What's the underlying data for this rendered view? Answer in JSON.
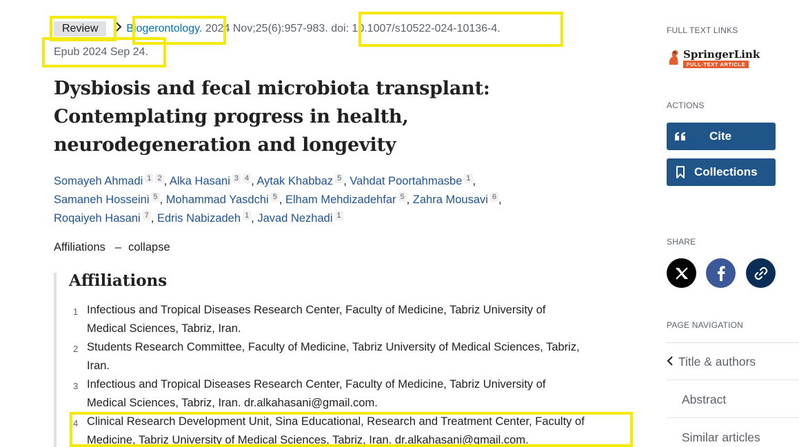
{
  "citation": {
    "badge": "Review",
    "journal": "Biogerontology.",
    "details": "2024 Nov;25(6):957-983.",
    "doi": "doi: 10.1007/s10522-024-10136-4.",
    "epub": "Epub 2024 Sep 24."
  },
  "title_lines": [
    "Dysbiosis and fecal microbiota transplant:",
    "Contemplating progress in health,",
    "neurodegeneration and longevity"
  ],
  "authors": [
    {
      "name": "Somayeh Ahmadi",
      "affs": [
        "1",
        "2"
      ]
    },
    {
      "name": "Alka Hasani",
      "affs": [
        "3",
        "4"
      ]
    },
    {
      "name": "Aytak Khabbaz",
      "affs": [
        "5"
      ]
    },
    {
      "name": "Vahdat Poortahmasbe",
      "affs": [
        "1"
      ]
    },
    {
      "name": "Samaneh Hosseini",
      "affs": [
        "5"
      ]
    },
    {
      "name": "Mohammad Yasdchi",
      "affs": [
        "5"
      ]
    },
    {
      "name": "Elham Mehdizadehfar",
      "affs": [
        "5"
      ]
    },
    {
      "name": "Zahra Mousavi",
      "affs": [
        "6"
      ]
    },
    {
      "name": "Roqaiyeh Hasani",
      "affs": [
        "7"
      ]
    },
    {
      "name": "Edris Nabizadeh",
      "affs": [
        "1"
      ]
    },
    {
      "name": "Javad Nezhadi",
      "affs": [
        "1"
      ]
    }
  ],
  "affiliations_toggle": {
    "label": "Affiliations",
    "dash": "–",
    "action": "collapse"
  },
  "affiliations_heading": "Affiliations",
  "affiliations": [
    {
      "num": "1",
      "lines": [
        "Infectious and Tropical Diseases Research Center, Faculty of Medicine, Tabriz University of",
        "Medical Sciences, Tabriz, Iran."
      ]
    },
    {
      "num": "2",
      "lines": [
        "Students Research Committee, Faculty of Medicine, Tabriz University of Medical Sciences, Tabriz,",
        "Iran."
      ]
    },
    {
      "num": "3",
      "lines": [
        "Infectious and Tropical Diseases Research Center, Faculty of Medicine, Tabriz University of",
        "Medical Sciences, Tabriz, Iran. dr.alkahasani@gmail.com."
      ]
    },
    {
      "num": "4",
      "lines": [
        "Clinical Research Development Unit, Sina Educational, Research and Treatment Center, Faculty of",
        "Medicine, Tabriz University of Medical Sciences, Tabriz, Iran. dr.alkahasani@gmail.com."
      ]
    }
  ],
  "sidebar": {
    "full_text_label": "FULL TEXT LINKS",
    "springer_name": "SpringerLink",
    "springer_tag": "FULL-TEXT ARTICLE",
    "actions_label": "ACTIONS",
    "cite_label": "Cite",
    "collections_label": "Collections",
    "share_label": "SHARE",
    "page_nav_label": "PAGE NAVIGATION",
    "nav_items": [
      "Title & authors",
      "Abstract",
      "Similar articles"
    ]
  },
  "colors": {
    "highlight": "#f5e90a",
    "button": "#20558a",
    "link": "#205493"
  }
}
